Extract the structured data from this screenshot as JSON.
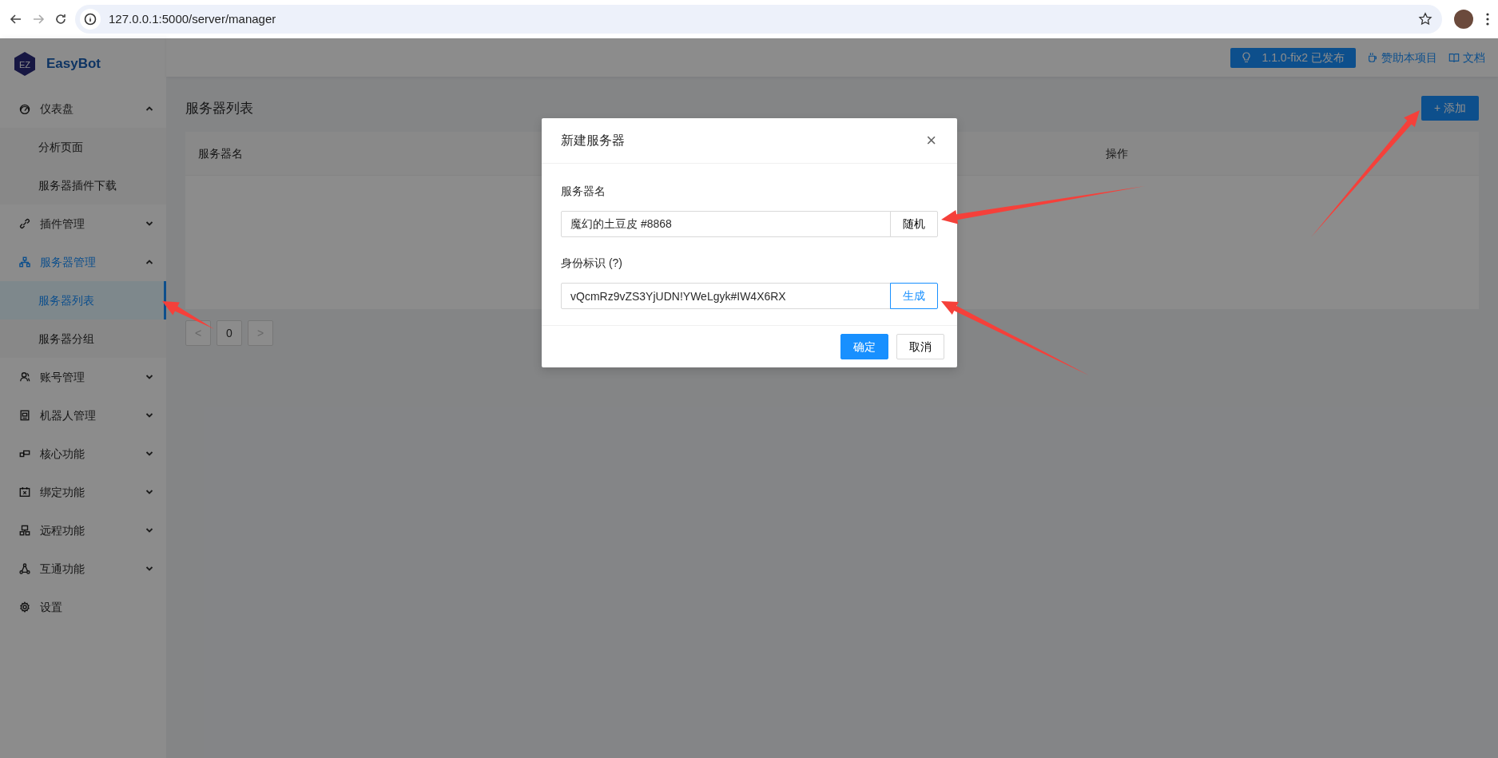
{
  "browser": {
    "url": "127.0.0.1:5000/server/manager"
  },
  "app": {
    "logo_text": "EZ",
    "name": "EasyBot"
  },
  "sidebar": {
    "items": [
      {
        "label": "仪表盘",
        "expanded": true,
        "children": [
          {
            "label": "分析页面",
            "selected": false
          },
          {
            "label": "服务器插件下载",
            "selected": false
          }
        ]
      },
      {
        "label": "插件管理",
        "expanded": false
      },
      {
        "label": "服务器管理",
        "expanded": true,
        "children": [
          {
            "label": "服务器列表",
            "selected": true
          },
          {
            "label": "服务器分组",
            "selected": false
          }
        ]
      },
      {
        "label": "账号管理",
        "expanded": false
      },
      {
        "label": "机器人管理",
        "expanded": false
      },
      {
        "label": "核心功能",
        "expanded": false
      },
      {
        "label": "绑定功能",
        "expanded": false
      },
      {
        "label": "远程功能",
        "expanded": false
      },
      {
        "label": "互通功能",
        "expanded": false
      },
      {
        "label": "设置"
      }
    ]
  },
  "header": {
    "version_badge": "1.1.0-fix2 已发布",
    "links": [
      "赞助本项目",
      "文档"
    ]
  },
  "page": {
    "title": "服务器列表",
    "add_button": "+ 添加",
    "table": {
      "columns": [
        "服务器名",
        "操作"
      ]
    },
    "pagination": {
      "prev": "<",
      "page": "0",
      "next": ">"
    }
  },
  "dialog": {
    "title": "新建服务器",
    "close": "×",
    "fields": [
      {
        "label": "服务器名",
        "value": "魔幻的土豆皮 #8868",
        "button": {
          "label": "随机",
          "kind": "default"
        }
      },
      {
        "label": "身份标识 (?)",
        "value": "vQcmRz9vZS3YjUDN!YWeLgyk#IW4X6RX",
        "button": {
          "label": "生成",
          "kind": "outline"
        }
      }
    ],
    "buttons": [
      {
        "label": "确定",
        "kind": "primary"
      },
      {
        "label": "取消",
        "kind": "default"
      }
    ]
  }
}
